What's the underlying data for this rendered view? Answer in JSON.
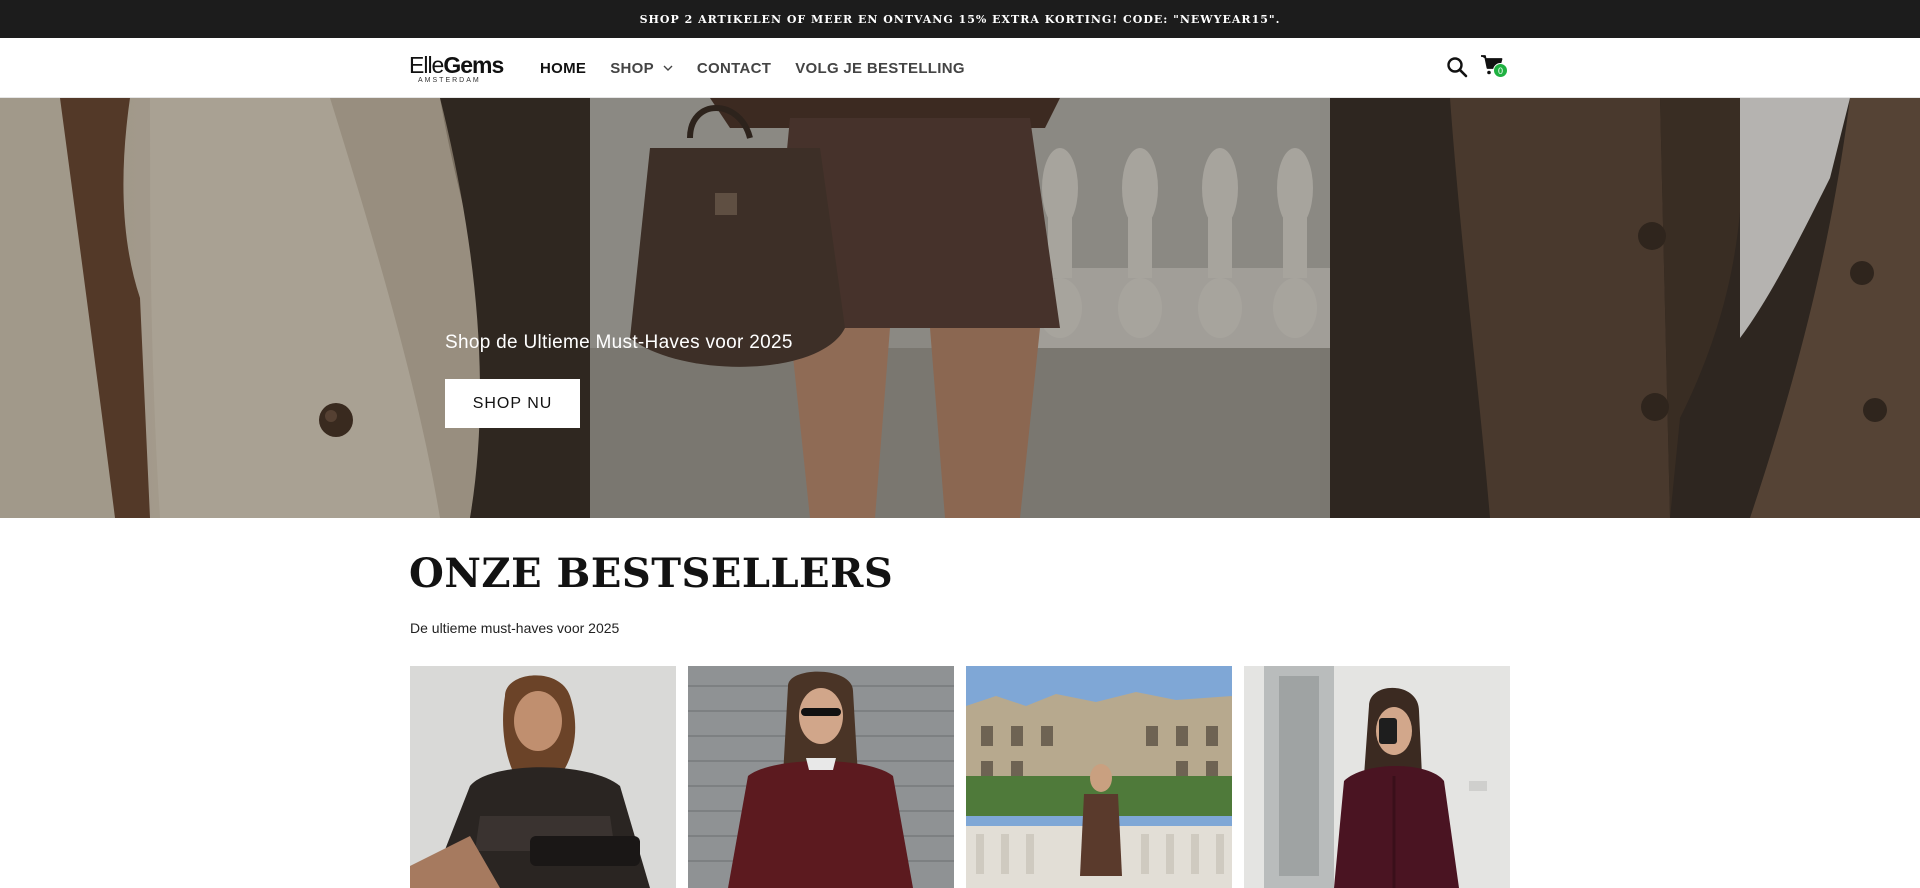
{
  "announcement": "SHOP 2 ARTIKELEN OF MEER EN ONTVANG 15% EXTRA KORTING! CODE: \"NEWYEAR15\".",
  "logo": {
    "part1": "Elle",
    "part2": "Gems",
    "sub": "AMSTERDAM"
  },
  "nav": {
    "items": [
      {
        "label": "HOME"
      },
      {
        "label": "SHOP"
      },
      {
        "label": "CONTACT"
      },
      {
        "label": "VOLG JE BESTELLING"
      }
    ]
  },
  "header": {
    "search_icon": "search-icon",
    "cart_icon": "cart-icon",
    "cart_count": "0"
  },
  "hero": {
    "title": "Shop de Ultieme Must-Haves voor 2025",
    "cta": "SHOP NU"
  },
  "bestsellers": {
    "title": "ONZE BESTSELLERS",
    "subtitle": "De ultieme must-haves voor 2025"
  },
  "colors": {
    "announcement_bg": "#1c1c1c",
    "cart_badge": "#1fb141",
    "text": "#121212"
  }
}
